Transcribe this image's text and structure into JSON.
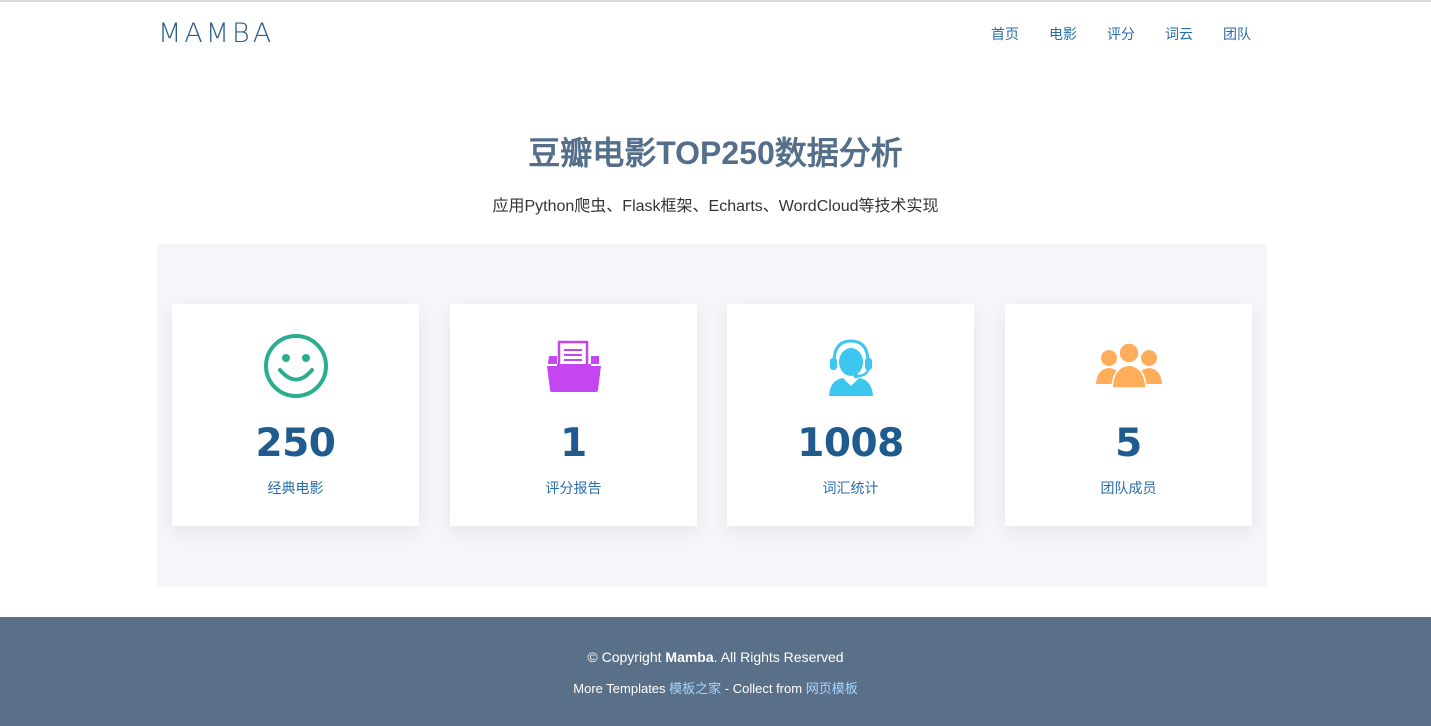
{
  "brand": "MAMBA",
  "nav": [
    "首页",
    "电影",
    "评分",
    "词云",
    "团队"
  ],
  "hero": {
    "title": "豆瓣电影TOP250数据分析",
    "subtitle": "应用Python爬虫、Flask框架、Echarts、WordCloud等技术实现"
  },
  "stats": [
    {
      "icon": "smiley-icon",
      "color": "#2bae8f",
      "value": "250",
      "label": "经典电影"
    },
    {
      "icon": "document-tray-icon",
      "color": "#c446f0",
      "value": "1",
      "label": "评分报告"
    },
    {
      "icon": "headset-agent-icon",
      "color": "#3cc6f0",
      "value": "1008",
      "label": "词汇统计"
    },
    {
      "icon": "team-people-icon",
      "color": "#ffad5a",
      "value": "5",
      "label": "团队成员"
    }
  ],
  "footer": {
    "copyright_prefix": "© Copyright ",
    "copyright_brand": "Mamba",
    "copyright_suffix": ". All Rights Reserved",
    "more_prefix": "More Templates ",
    "more_link": "模板之家",
    "collect_text": " - Collect from ",
    "collect_link": "网页模板"
  }
}
